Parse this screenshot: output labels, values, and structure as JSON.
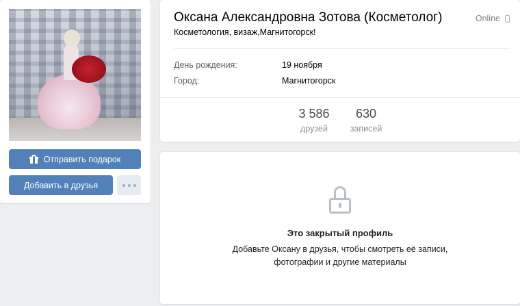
{
  "profile": {
    "name": "Оксана Александровна Зотова (Косметолог)",
    "status": "Косметология, визаж,Магнитогорск!",
    "online": "Online"
  },
  "actions": {
    "gift_label": "Отправить подарок",
    "add_friend_label": "Добавить в друзья"
  },
  "info": [
    {
      "label": "День рождения:",
      "value": "19 ноября"
    },
    {
      "label": "Город:",
      "value": "Магнитогорск"
    }
  ],
  "counters": [
    {
      "value": "3 586",
      "label": "друзей"
    },
    {
      "value": "630",
      "label": "записей"
    }
  ],
  "private": {
    "title": "Это закрытый профиль",
    "line1": "Добавьте Оксану в друзья, чтобы смотреть её записи,",
    "line2": "фотографии и другие материалы"
  },
  "colors": {
    "accent": "#5181b8",
    "background": "#edeef0"
  },
  "icons": {
    "gift": "gift-icon",
    "more": "more-dots-icon",
    "lock": "lock-icon",
    "mobile": "mobile-phone-icon"
  }
}
